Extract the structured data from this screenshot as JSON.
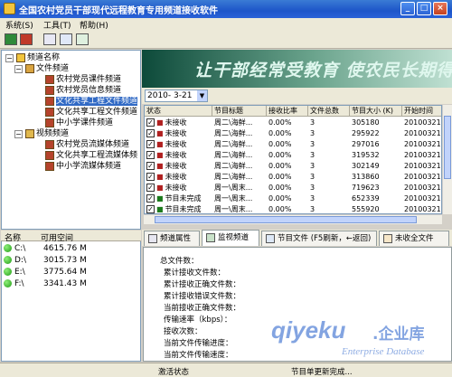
{
  "window": {
    "title": "全国农村党员干部现代远程教育专用频道接收软件",
    "buttons": [
      "_",
      "□",
      "×"
    ]
  },
  "menu": [
    "系统(S)",
    "工具(T)",
    "帮助(H)"
  ],
  "tree": {
    "header": "频道名称",
    "groups": [
      {
        "label": "文件频道",
        "items": [
          "农村党员课件频道",
          "农村党员信息频道",
          "文化共享工程文件频道",
          "文化共享工程文件频道",
          "中小学课件频道"
        ],
        "selected_index": 2
      },
      {
        "label": "视频频道",
        "items": [
          "农村党员流媒体频道",
          "文化共享工程流媒体频",
          "中小学流媒体频道"
        ]
      }
    ]
  },
  "drives": {
    "columns": [
      "名称",
      "可用空间"
    ],
    "rows": [
      {
        "name": "C:\\",
        "space": "4615.76 M"
      },
      {
        "name": "D:\\",
        "space": "3015.73 M"
      },
      {
        "name": "E:\\",
        "space": "3775.64 M"
      },
      {
        "name": "F:\\",
        "space": "3341.43 M"
      }
    ]
  },
  "banner": {
    "text": "让干部经常受教育   使农民长期得实惠"
  },
  "date_select": {
    "value": "2010- 3-21",
    "arrow": "▼"
  },
  "table": {
    "columns": [
      "状态",
      "节目标题",
      "接收比率",
      "文件总数",
      "节目大小 (K)",
      "开始时间"
    ],
    "rows": [
      {
        "status": "未接收",
        "title": "周二\\海鲜...",
        "ratio": "0.00%",
        "files": "3",
        "size": "305180",
        "start": "20100321"
      },
      {
        "status": "未接收",
        "title": "周二\\海鲜...",
        "ratio": "0.00%",
        "files": "3",
        "size": "295922",
        "start": "20100321"
      },
      {
        "status": "未接收",
        "title": "周二\\海鲜...",
        "ratio": "0.00%",
        "files": "3",
        "size": "297016",
        "start": "20100321"
      },
      {
        "status": "未接收",
        "title": "周二\\海鲜...",
        "ratio": "0.00%",
        "files": "3",
        "size": "319532",
        "start": "20100321"
      },
      {
        "status": "未接收",
        "title": "周二\\海鲜...",
        "ratio": "0.00%",
        "files": "3",
        "size": "302149",
        "start": "20100321"
      },
      {
        "status": "未接收",
        "title": "周二\\海鲜...",
        "ratio": "0.00%",
        "files": "3",
        "size": "313860",
        "start": "20100321"
      },
      {
        "status": "未接收",
        "title": "周一\\周末...",
        "ratio": "0.00%",
        "files": "3",
        "size": "719623",
        "start": "20100321"
      },
      {
        "status": "节目未完成",
        "title": "周一\\周末...",
        "ratio": "0.00%",
        "files": "3",
        "size": "652339",
        "start": "20100321"
      },
      {
        "status": "节目未完成",
        "title": "周一\\周末...",
        "ratio": "0.00%",
        "files": "3",
        "size": "555920",
        "start": "20100321"
      }
    ]
  },
  "tabs": [
    {
      "label": "频道属性"
    },
    {
      "label": "监视频道"
    },
    {
      "label": "节目文件 (F5刷新，←返回)"
    },
    {
      "label": "未收全文件"
    }
  ],
  "info_lines": [
    "总文件数：",
    "累计接收文件数：",
    "累计接收正确文件数：",
    "累计接收错误文件数：",
    "当前接收正确文件数：",
    "传输速率（kbps）：",
    "接收次数：",
    "当前文件传输进度：",
    "当前文件传输速度："
  ],
  "status": {
    "left": "激活状态",
    "right": "节目单更新完成..."
  },
  "watermark": {
    "main": "qiyeku",
    "domain_cn": ".企业库",
    "en": "Enterprise Database"
  }
}
